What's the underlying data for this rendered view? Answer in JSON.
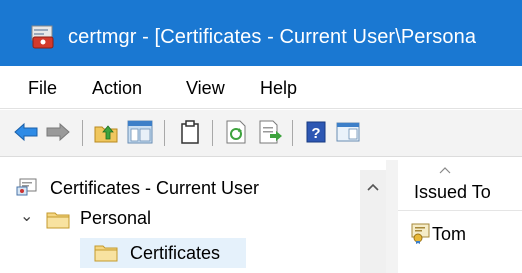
{
  "window": {
    "title": "certmgr - [Certificates - Current User\\Persona"
  },
  "menu": [
    "File",
    "Action",
    "View",
    "Help"
  ],
  "toolbar": {
    "buttons": [
      "back-icon",
      "forward-icon",
      "up-folder-icon",
      "show-hide-tree-icon",
      "properties-icon",
      "refresh-icon",
      "export-list-icon",
      "help-icon",
      "action-pane-icon"
    ]
  },
  "tree": {
    "root": "Certificates - Current User",
    "personal": "Personal",
    "certificates": "Certificates"
  },
  "list": {
    "column_issued_to": "Issued To",
    "rows": [
      {
        "issued_to": "Tom"
      }
    ]
  },
  "colors": {
    "titlebar": "#1a78d2",
    "selection": "#e5f1fb"
  }
}
